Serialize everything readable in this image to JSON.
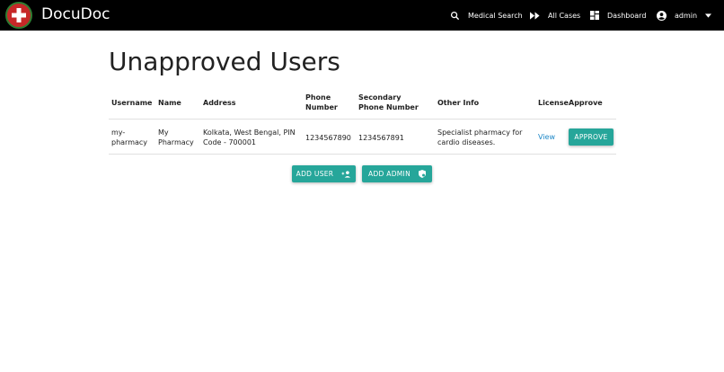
{
  "navbar": {
    "brand": "DocuDoc",
    "items": [
      {
        "label": "Medical Search",
        "icon": "search-icon"
      },
      {
        "label": "All Cases",
        "icon": "fast-forward-icon"
      },
      {
        "label": "Dashboard",
        "icon": "dashboard-icon"
      },
      {
        "label": "admin",
        "icon": "account-circle-icon"
      }
    ]
  },
  "page": {
    "title": "Unapproved Users"
  },
  "table": {
    "headers": [
      "Username",
      "Name",
      "Address",
      "Phone Number",
      "Secondary Phone Number",
      "Other Info",
      "License",
      "Approve"
    ],
    "rows": [
      {
        "username": "my-pharmacy",
        "name": "My Pharmacy",
        "address": "Kolkata, West Bengal, PIN Code - 700001",
        "phone": "1234567890",
        "secondary_phone": "1234567891",
        "other_info": "Specialist pharmacy for cardio diseases.",
        "license_link": "View",
        "approve_button": "APPROVE"
      }
    ]
  },
  "actions": {
    "add_user": "ADD USER",
    "add_admin": "ADD ADMIN"
  },
  "colors": {
    "navbar": "#000000",
    "accent": "#26a69a",
    "link": "#1e88c7",
    "logo_red": "#c62828",
    "logo_ring": "#2e7d32"
  }
}
